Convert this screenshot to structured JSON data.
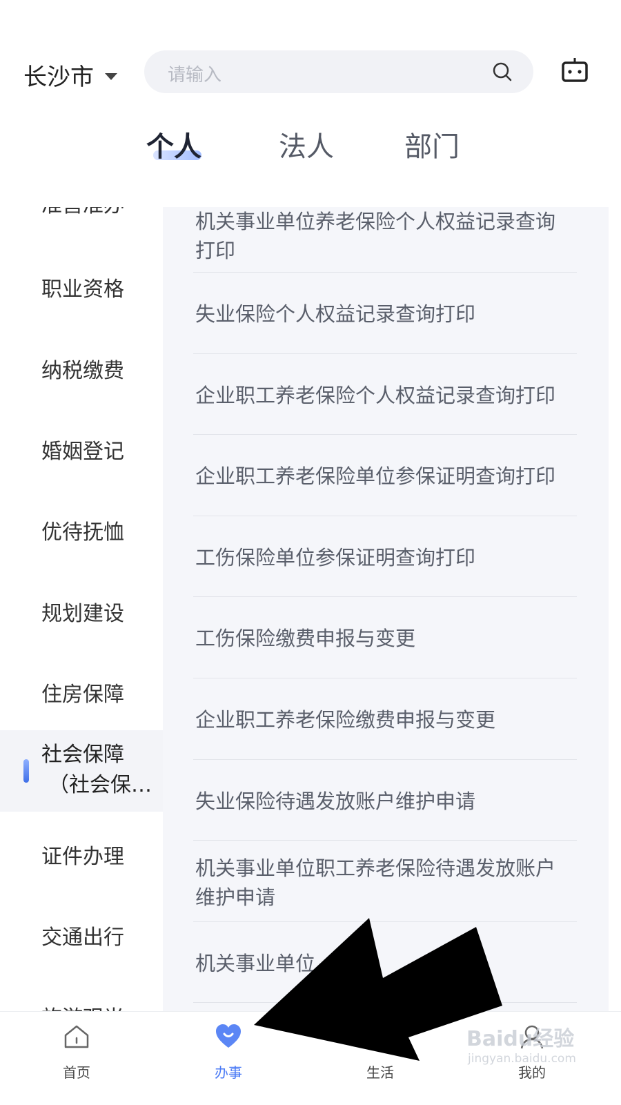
{
  "header": {
    "city": "长沙市",
    "search_placeholder": "请输入",
    "tabs": [
      {
        "label": "个人",
        "active": true
      },
      {
        "label": "法人",
        "active": false
      },
      {
        "label": "部门",
        "active": false
      }
    ]
  },
  "sidebar": {
    "partial_top": "准营准办",
    "items": [
      {
        "label": "职业资格"
      },
      {
        "label": "纳税缴费"
      },
      {
        "label": "婚姻登记"
      },
      {
        "label": "优待抚恤"
      },
      {
        "label": "规划建设"
      },
      {
        "label": "住房保障"
      },
      {
        "label_line1": "社会保障",
        "label_line2": "（社会保…",
        "active": true
      },
      {
        "label": "证件办理"
      },
      {
        "label": "交通出行"
      }
    ],
    "partial_bottom": "旅游观光"
  },
  "services": [
    {
      "line1": "机关事业单位养老保险个人权益记录查询",
      "line2": "打印"
    },
    {
      "line1": "失业保险个人权益记录查询打印"
    },
    {
      "line1": "企业职工养老保险个人权益记录查询打印"
    },
    {
      "line1": "企业职工养老保险单位参保证明查询打印"
    },
    {
      "line1": "工伤保险单位参保证明查询打印"
    },
    {
      "line1": "工伤保险缴费申报与变更"
    },
    {
      "line1": "企业职工养老保险缴费申报与变更"
    },
    {
      "line1": "失业保险待遇发放账户维护申请"
    },
    {
      "line1": "机关事业单位职工养老保险待遇发放账户",
      "line2": "维护申请"
    },
    {
      "line1": "机关事业单位"
    }
  ],
  "bottom_nav": [
    {
      "label": "首页",
      "icon": "home-icon"
    },
    {
      "label": "办事",
      "icon": "heart-smile-icon",
      "active": true
    },
    {
      "label": "生活",
      "icon": "life-icon"
    },
    {
      "label": "我的",
      "icon": "profile-icon"
    }
  ],
  "watermark": {
    "brand": "Baidu经验",
    "url": "jingyan.baidu.com"
  },
  "colors": {
    "accent": "#4a7af5",
    "list_bg": "#f5f6fa",
    "arrow": "#000000"
  }
}
